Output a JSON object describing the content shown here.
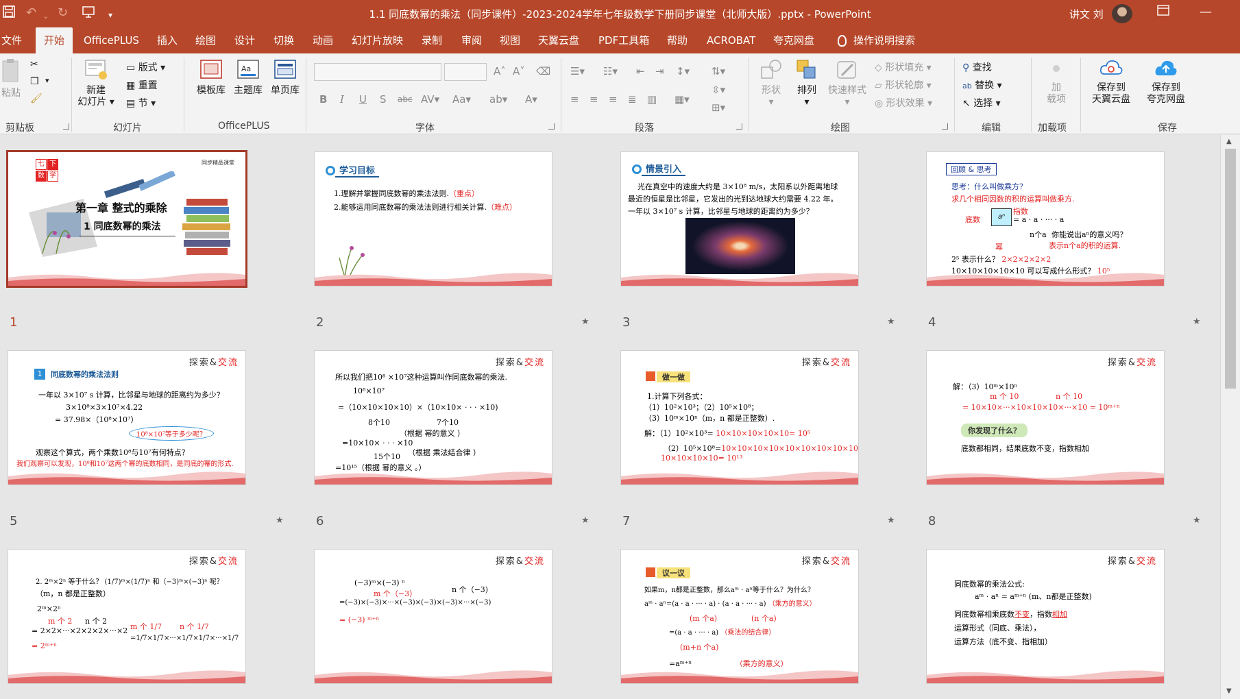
{
  "window": {
    "title": "1.1 同底数幂的乘法（同步课件）-2023-2024学年七年级数学下册同步课堂（北师大版）.pptx  -  PowerPoint",
    "user": "讲文 刘"
  },
  "tabs": [
    "文件",
    "开始",
    "OfficePLUS",
    "插入",
    "绘图",
    "设计",
    "切换",
    "动画",
    "幻灯片放映",
    "录制",
    "审阅",
    "视图",
    "天翼云盘",
    "PDF工具箱",
    "帮助",
    "ACROBAT",
    "夸克网盘"
  ],
  "tell_me": "操作说明搜索",
  "ribbon": {
    "clipboard": {
      "paste": "粘贴",
      "label": "剪贴板"
    },
    "slides": {
      "new": "新建",
      "new2": "幻灯片",
      "layout": "版式",
      "reset": "重置",
      "section": "节",
      "label": "幻灯片"
    },
    "officeplus": {
      "template": "模板库",
      "theme": "主题库",
      "single": "单页库",
      "label": "OfficePLUS"
    },
    "font": {
      "label": "字体"
    },
    "paragraph": {
      "label": "段落"
    },
    "drawing": {
      "shape": "形状",
      "arrange": "排列",
      "quick": "快速样式",
      "fill": "形状填充",
      "outline": "形状轮廓",
      "effect": "形状效果",
      "label": "绘图"
    },
    "editing": {
      "find": "查找",
      "replace": "替换",
      "select": "选择",
      "label": "编辑"
    },
    "addins": {
      "add": "加",
      "add2": "载项",
      "label": "加载项"
    },
    "save": {
      "tianyi": "保存到",
      "tianyi2": "天翼云盘",
      "quark": "保存到",
      "quark2": "夸克网盘",
      "label": "保存"
    }
  },
  "slides": [
    {
      "num": "1",
      "chapter": "第一章  整式的乘除",
      "title": "1 同底数幂的乘法",
      "tag1": "七",
      "tag2": "下",
      "tag3": "数",
      "tag4": "学",
      "brand": "同步精品课堂"
    },
    {
      "num": "2",
      "head": "学习目标",
      "l1": "1.理解并掌握同底数幂的乘法法则.",
      "l1r": "（重点）",
      "l2": "2.能够运用同底数幂的乘法法则进行相关计算.",
      "l2r": "（难点）"
    },
    {
      "num": "3",
      "head": "情景引入",
      "l1": "光在真空中的速度大约是  3×10⁸ m/s，太阳系以外距离地球",
      "l2": "最近的恒星是比邻星，它发出的光到达地球大约需要 4.22 年。",
      "l3": "一年以 3×10⁷ s 计算，比邻星与地球的距离约为多少？"
    },
    {
      "num": "4",
      "head": "回顾 & 思考",
      "l1": "思考：什么叫做乘方？",
      "l2": "求几个相同因数的积的运算叫做乘方.",
      "base": "底数",
      "exp": "指数",
      "pow": "幂",
      "mid": "= a · a · ··· · a",
      "count": "n个a",
      "q": "你能说出aⁿ的意义吗？",
      "a": "表示n个a的积的运算.",
      "l3": "2⁵ 表示什么？",
      "l3r": "2×2×2×2×2",
      "l4": "10×10×10×10×10 可以写成什么形式？",
      "l4r": "10⁵"
    },
    {
      "num": "5",
      "tag": "探索",
      "tag2": "交流",
      "head": "同底数幂的乘法法则",
      "l1": "一年以 3×10⁷ s 计算，比邻星与地球的距离约为多少？",
      "l2": "3×10⁸×3×10⁷×4.22",
      "l3": "= 37.98×（10⁸×10⁷）",
      "bubble": "10⁸×10⁷等于多少呢？",
      "l4": "观察这个算式，两个乘数10⁸与10⁷有何特点？",
      "l5": "我们观察可以发现，10⁸和10⁷这两个幂的底数相同，是同底的幂的形式."
    },
    {
      "num": "6",
      "tag": "探索",
      "tag2": "交流",
      "l1": "所以我们把10⁸ ×10⁷这种运算叫作同底数幂的乘法.",
      "l2": "10⁸×10⁷",
      "l3": "=（10×10×10×10）×（10×10× · · · ×10)",
      "l4": "8个10",
      "l5": "7个10",
      "l6": "（根据 幂的意义 ）",
      "l7": "=10×10× · · · ×10",
      "l8": "15个10",
      "l9": "（根据 乘法结合律 ）",
      "l10": "=10¹⁵（根据  幂的意义 。）"
    },
    {
      "num": "7",
      "tag": "探索",
      "tag2": "交流",
      "head": "做一做",
      "l1": "1.计算下列各式：",
      "l2": "（1）10²×10³；（2）10⁵×10⁸；",
      "l3": "（3）10ᵐ×10ⁿ（m，n 都是正整数）.",
      "l4": "解：（1）10²×10³= ",
      "l4r": "10×10×10×10×10= 10⁵",
      "l5": "（2）10⁵×10⁸=",
      "l5r": "10×10×10×10×10×10×10×10×10×10",
      "l6r": "10×10×10×10= 10¹³"
    },
    {
      "num": "8",
      "tag": "探索",
      "tag2": "交流",
      "l1": "解：（3）10ᵐ×10ⁿ",
      "l2": "m 个 10",
      "l3": "n 个 10",
      "l4": "= 10×10×···×10×10×10×···×10  = 10ᵐ⁺ⁿ",
      "btn": "你发现了什么？",
      "l5": "底数都相同，结果底数不变，指数相加"
    },
    {
      "num": "9",
      "tag": "探索",
      "tag2": "交流",
      "l1": "2. 2ᵐ×2ⁿ 等于什么？ (1/7)ᵐ×(1/7)ⁿ 和（−3)ᵐ×(−3)ⁿ 呢？",
      "l2": "（m，n 都是正整数）",
      "l3": "2ᵐ×2ⁿ",
      "l4": "m 个 2",
      "l5": "n 个 2",
      "l6": "= 2×2×···×2×2×2×···×2",
      "l7": "= 2ᵐ⁺ⁿ",
      "l8": "m 个 1/7",
      "l9": "n 个 1/7"
    },
    {
      "num": "10",
      "tag": "探索",
      "tag2": "交流",
      "l1": "(−3)ᵐ×(−3) ⁿ",
      "l2": "m 个（−3）",
      "l3": "n 个（−3)",
      "l4": "=(−3)×(−3)×···×(−3)×(−3)×(−3)×···×(−3)",
      "l5": "= (−3) ᵐ⁺ⁿ"
    },
    {
      "num": "11",
      "tag": "探索",
      "tag2": "交流",
      "head": "议一议",
      "l1": "如果m，n都是正整数，那么aᵐ · aⁿ等于什么？为什么？",
      "l2": "aᵐ · aⁿ=(a · a · ··· · a) · (a · a · ··· · a)",
      "l2r": "（乘方的意义）",
      "l3": "(m 个a)",
      "l4": "(n 个a)",
      "l5": "=(a · a · ··· · a)",
      "l5r": "（乘法的结合律）",
      "l6": "(m+n 个a)",
      "l7": "=aᵐ⁺ⁿ",
      "l7r": "（乘方的意义）"
    },
    {
      "num": "12",
      "tag": "探索",
      "tag2": "交流",
      "l1": "同底数幂的乘法公式:",
      "l2": "aᵐ · aⁿ = aᵐ⁺ⁿ (m、n都是正整数)",
      "l3": "同底数幂相乘底数",
      "l3a": "不变",
      "l3b": "，指数",
      "l3c": "相加",
      "l4": "运算形式（同底、乘法），",
      "l5": "运算方法（底不变、指相加）"
    }
  ]
}
